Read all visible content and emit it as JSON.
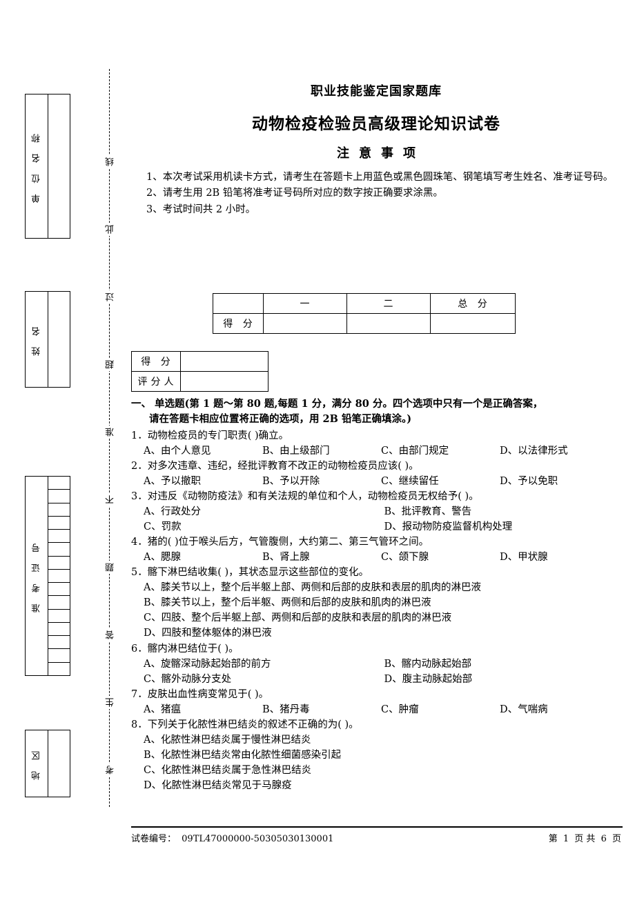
{
  "header": {
    "org_title": "职业技能鉴定国家题库",
    "paper_title": "动物检疫检验员高级理论知识试卷",
    "notice_title": "注意事项",
    "notes": [
      "1、本次考试采用机读卡方式，请考生在答题卡上用蓝色或黑色圆珠笔、钢笔填写考生姓名、准考证号码。",
      "2、请考生用 2B 铅笔将准考证号码所对应的数字按正确要求涂黑。",
      "3、考试时间共 2 小时。"
    ]
  },
  "margin": {
    "boxes": [
      {
        "label": "单 位 名 称",
        "cells": 1
      },
      {
        "label": "姓    名",
        "cells": 1
      },
      {
        "label": "准 考 证 号",
        "cells": 15
      },
      {
        "label": "地    区",
        "cells": 1
      }
    ],
    "dashed_line_chars": [
      "线",
      "此",
      "过",
      "超",
      "准",
      "不",
      "题",
      "答",
      "生",
      "考"
    ]
  },
  "score_table": {
    "headers": [
      "",
      "一",
      "二",
      "总  分"
    ],
    "row_label": "得  分",
    "values": [
      "",
      "",
      ""
    ]
  },
  "grader_table": {
    "rows": [
      {
        "label": "得  分",
        "value": ""
      },
      {
        "label": "评分人",
        "value": ""
      }
    ]
  },
  "section": {
    "heading_line1": "一、 单选题(第 1 题～第 80 题,每题 1 分，满分 80 分。四个选项中只有一个是正确答案，",
    "heading_line2": "请在答题卡相应位置将正确的选项，用 2B 铅笔正确填涂。)"
  },
  "questions": [
    {
      "stem": "1．动物检疫员的专门职责(      )确立。",
      "layout": "cols4",
      "options": [
        "A、由个人意见",
        "B、由上级部门",
        "C、由部门规定",
        "D、以法律形式"
      ]
    },
    {
      "stem": "2．对多次违章、违纪，经批评教育不改正的动物检疫员应该(      )。",
      "layout": "cols4",
      "options": [
        "A、予以撤职",
        "B、予以开除",
        "C、继续留任",
        "D、予以免职"
      ]
    },
    {
      "stem": "3．对违反《动物防疫法》和有关法规的单位和个人，动物检疫员无权给予(      )。",
      "layout": "cols2",
      "options": [
        "A、行政处分",
        "B、批评教育、警告",
        "C、罚款",
        "D、报动物防疫监督机构处理"
      ]
    },
    {
      "stem": "4．猪的(      )位于喉头后方，气管腹侧，大约第二、第三气管环之间。",
      "layout": "cols4",
      "options": [
        "A、腮腺",
        "B、肾上腺",
        "C、颌下腺",
        "D、甲状腺"
      ]
    },
    {
      "stem": "5．髂下淋巴结收集(      )，其状态显示这些部位的变化。",
      "layout": "full",
      "options": [
        "A、膝关节以上，整个后半躯上部、两侧和后部的皮肤和表层的肌肉的淋巴液",
        "B、膝关节以上，整个后半躯、两侧和后部的皮肤和肌肉的淋巴液",
        "C、四肢、整个后半躯上部、两侧和后部的皮肤和表层的肌肉的淋巴液",
        "D、四肢和整体躯体的淋巴液"
      ]
    },
    {
      "stem": "6．髂内淋巴结位于(      )。",
      "layout": "cols2",
      "options": [
        "A、旋髂深动脉起始部的前方",
        "B、髂内动脉起始部",
        "C、髂外动脉分支处",
        "D、腹主动脉起始部"
      ]
    },
    {
      "stem": "7．皮肤出血性病变常见于(      )。",
      "layout": "cols4",
      "options": [
        "A、猪瘟",
        "B、猪丹毒",
        "C、肿瘤",
        "D、气喘病"
      ]
    },
    {
      "stem": "8．下列关于化脓性淋巴结炎的叙述不正确的为(      )。",
      "layout": "full",
      "options": [
        "A、化脓性淋巴结炎属于慢性淋巴结炎",
        "B、化脓性淋巴结炎常由化脓性细菌感染引起",
        "C、化脓性淋巴结炎属于急性淋巴结炎",
        "D、化脓性淋巴结炎常见于马腺疫"
      ]
    }
  ],
  "footer": {
    "paper_no_label": "试卷编号：",
    "paper_no": "09TL47000000-50305030130001",
    "page_prefix": "第",
    "page_current": "1",
    "page_mid": "页  共",
    "page_total": "6",
    "page_suffix": "页"
  }
}
